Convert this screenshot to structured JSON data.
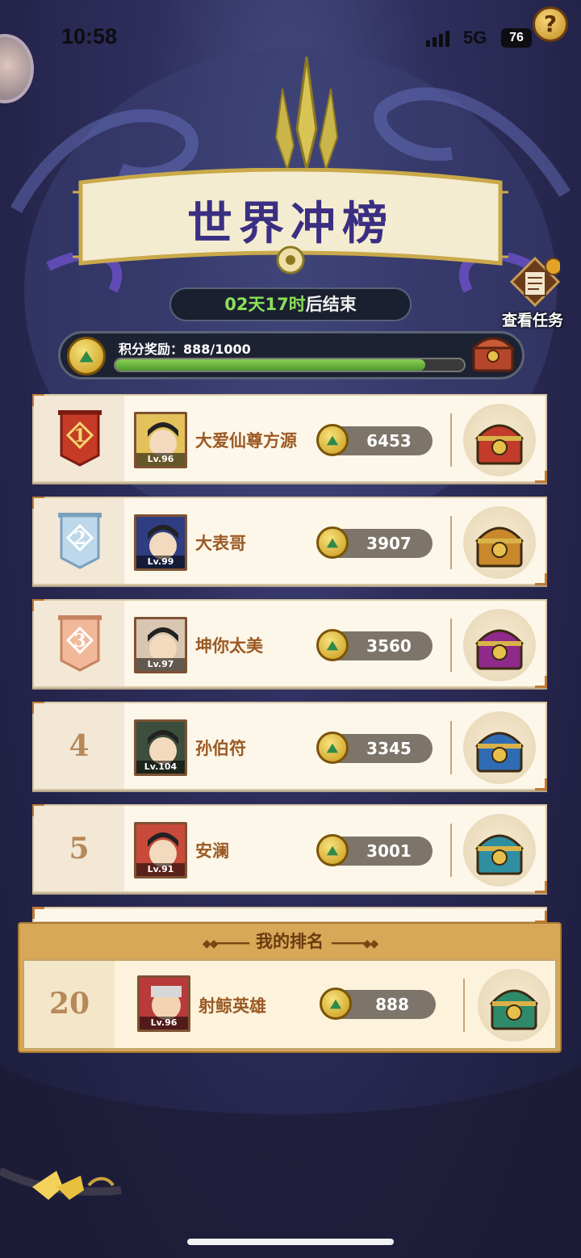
{
  "status_bar": {
    "time": "10:58",
    "network": "5G",
    "battery": "76"
  },
  "help": {
    "label": "?"
  },
  "banner": {
    "title": "世界冲榜"
  },
  "timer": {
    "highlight": "02天17时",
    "suffix": "后结束"
  },
  "tasks": {
    "label": "查看任务"
  },
  "points": {
    "label": "积分奖励：",
    "value": "888/1000",
    "progress": 0.888
  },
  "rankings": [
    {
      "rank": "1",
      "name": "大爱仙尊方源",
      "level": "Lv.96",
      "score": "6453",
      "medal": "gold",
      "chest_color": "#c23b2b"
    },
    {
      "rank": "2",
      "name": "大表哥",
      "level": "Lv.99",
      "score": "3907",
      "medal": "silver",
      "chest_color": "#c9882b"
    },
    {
      "rank": "3",
      "name": "坤你太美",
      "level": "Lv.97",
      "score": "3560",
      "medal": "bronze",
      "chest_color": "#8e2a8a"
    },
    {
      "rank": "4",
      "name": "孙伯符",
      "level": "Lv.104",
      "score": "3345",
      "medal": "none",
      "chest_color": "#2f6cb3"
    },
    {
      "rank": "5",
      "name": "安澜",
      "level": "Lv.91",
      "score": "3001",
      "medal": "none",
      "chest_color": "#2f8fa0"
    }
  ],
  "my_rank": {
    "header": "我的排名",
    "rank": "20",
    "name": "射鲸英雄",
    "level": "Lv.96",
    "score": "888",
    "chest_color": "#2f8a6a"
  }
}
